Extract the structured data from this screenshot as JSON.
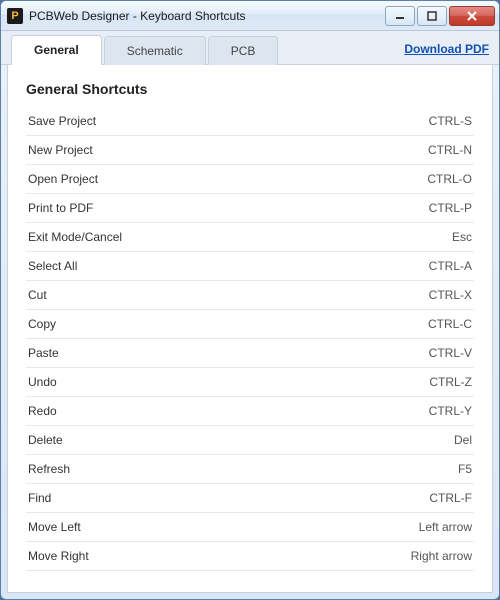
{
  "window": {
    "title": "PCBWeb Designer - Keyboard Shortcuts",
    "app_icon_letter": "P"
  },
  "tabs": [
    {
      "label": "General",
      "active": true
    },
    {
      "label": "Schematic",
      "active": false
    },
    {
      "label": "PCB",
      "active": false
    }
  ],
  "download_link": "Download PDF",
  "section_title": "General Shortcuts",
  "shortcuts": [
    {
      "action": "Save Project",
      "key": "CTRL-S"
    },
    {
      "action": "New Project",
      "key": "CTRL-N"
    },
    {
      "action": "Open Project",
      "key": "CTRL-O"
    },
    {
      "action": "Print to PDF",
      "key": "CTRL-P"
    },
    {
      "action": "Exit Mode/Cancel",
      "key": "Esc"
    },
    {
      "action": "Select All",
      "key": "CTRL-A"
    },
    {
      "action": "Cut",
      "key": "CTRL-X"
    },
    {
      "action": "Copy",
      "key": "CTRL-C"
    },
    {
      "action": "Paste",
      "key": "CTRL-V"
    },
    {
      "action": "Undo",
      "key": "CTRL-Z"
    },
    {
      "action": "Redo",
      "key": "CTRL-Y"
    },
    {
      "action": "Delete",
      "key": "Del"
    },
    {
      "action": "Refresh",
      "key": "F5"
    },
    {
      "action": "Find",
      "key": "CTRL-F"
    },
    {
      "action": "Move Left",
      "key": "Left arrow"
    },
    {
      "action": "Move Right",
      "key": "Right arrow"
    }
  ]
}
